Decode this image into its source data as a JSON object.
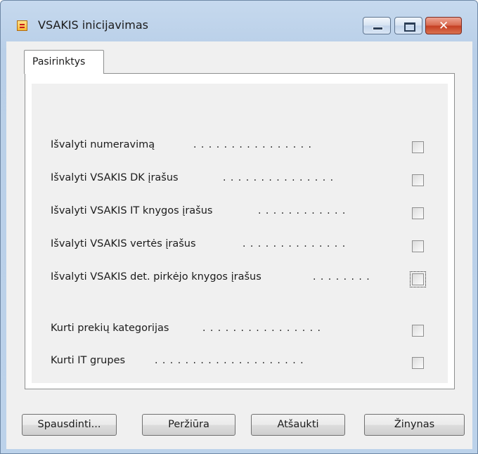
{
  "window": {
    "title": "VSAKIS inicijavimas",
    "caption_buttons": {
      "minimize": "minimize-icon",
      "maximize": "maximize-icon",
      "close": "close-icon"
    }
  },
  "tabs": [
    {
      "label": "Pasirinktys",
      "selected": true
    }
  ],
  "options": [
    {
      "label": "Išvalyti numeravimą",
      "checked": false
    },
    {
      "label": "Išvalyti VSAKIS DK įrašus",
      "checked": false
    },
    {
      "label": "Išvalyti VSAKIS IT knygos įrašus",
      "checked": false
    },
    {
      "label": "Išvalyti VSAKIS vertės įrašus",
      "checked": false
    },
    {
      "label": "Išvalyti VSAKIS det. pirkėjo knygos įrašus",
      "checked": false,
      "focused": true
    },
    {
      "label": "Kurti prekių kategorijas",
      "checked": false
    },
    {
      "label": "Kurti IT grupes",
      "checked": false
    }
  ],
  "buttons": {
    "print": "Spausdinti...",
    "preview": "Peržiūra",
    "cancel": "Atšaukti",
    "help": "Žinynas"
  },
  "colors": {
    "close_button": "#c53d22",
    "title_bar": "#c6d9ee",
    "dialog_face": "#f0f0f0"
  }
}
